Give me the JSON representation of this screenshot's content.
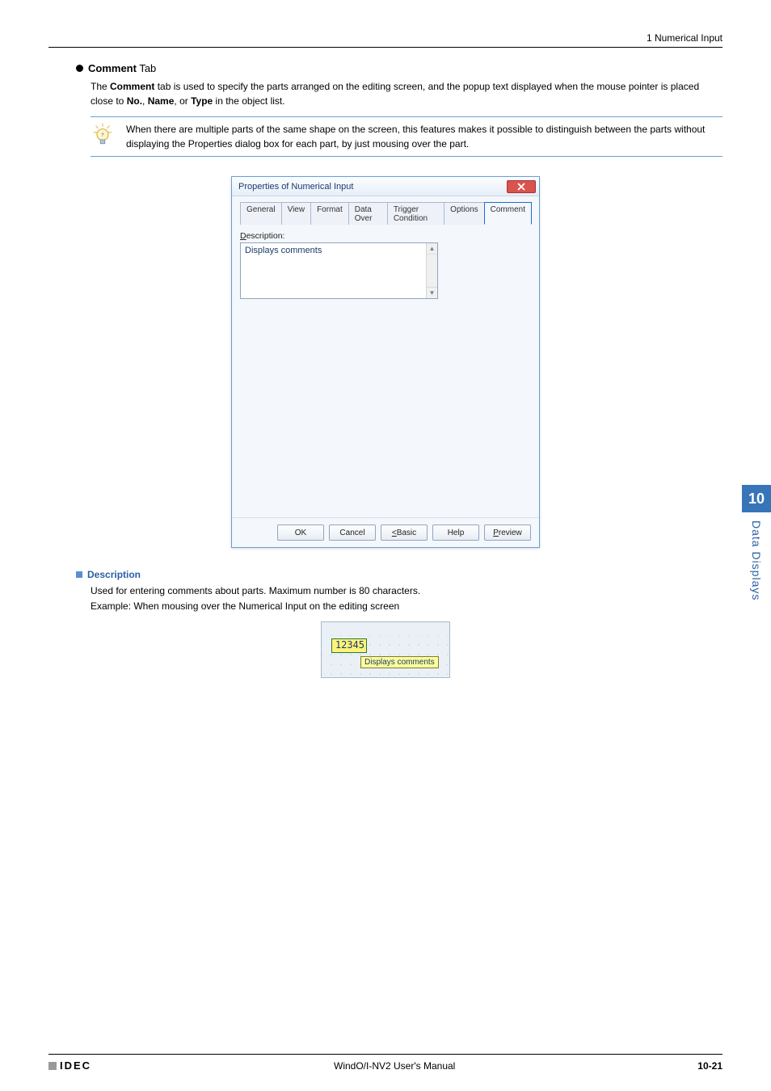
{
  "header": {
    "section": "1 Numerical Input"
  },
  "comment_tab": {
    "heading_prefix": "Comment",
    "heading_suffix": " Tab",
    "paragraph_html": "The <b>Comment</b> tab is used to specify the parts arranged on the editing screen, and the popup text displayed when the mouse pointer is placed close to <b>No.</b>, <b>Name</b>, or <b>Type</b> in the object list."
  },
  "note": {
    "text": "When there are multiple parts of the same shape on the screen, this features makes it possible to distinguish between the parts without displaying the Properties dialog box for each part, by just mousing over the part."
  },
  "dialog": {
    "title": "Properties of Numerical Input",
    "tabs": [
      "General",
      "View",
      "Format",
      "Data Over",
      "Trigger Condition",
      "Options",
      "Comment"
    ],
    "active_tab_index": 6,
    "description_label_under": "D",
    "description_label_rest": "escription:",
    "description_value": "Displays comments",
    "buttons": {
      "ok": "OK",
      "cancel": "Cancel",
      "basic_under": "<",
      "basic_rest": " Basic",
      "help": "Help",
      "preview_under": "P",
      "preview_rest": "review"
    }
  },
  "description": {
    "heading": "Description",
    "line1": "Used for entering comments about parts. Maximum number is 80 characters.",
    "line2": "Example: When mousing over the Numerical Input on the editing screen"
  },
  "tooltip_fig": {
    "value": "12345",
    "popup": "Displays comments"
  },
  "side": {
    "num": "10",
    "label": "Data Displays"
  },
  "footer": {
    "logo": "IDEC",
    "center": "WindO/I-NV2 User's Manual",
    "right": "10-21"
  }
}
